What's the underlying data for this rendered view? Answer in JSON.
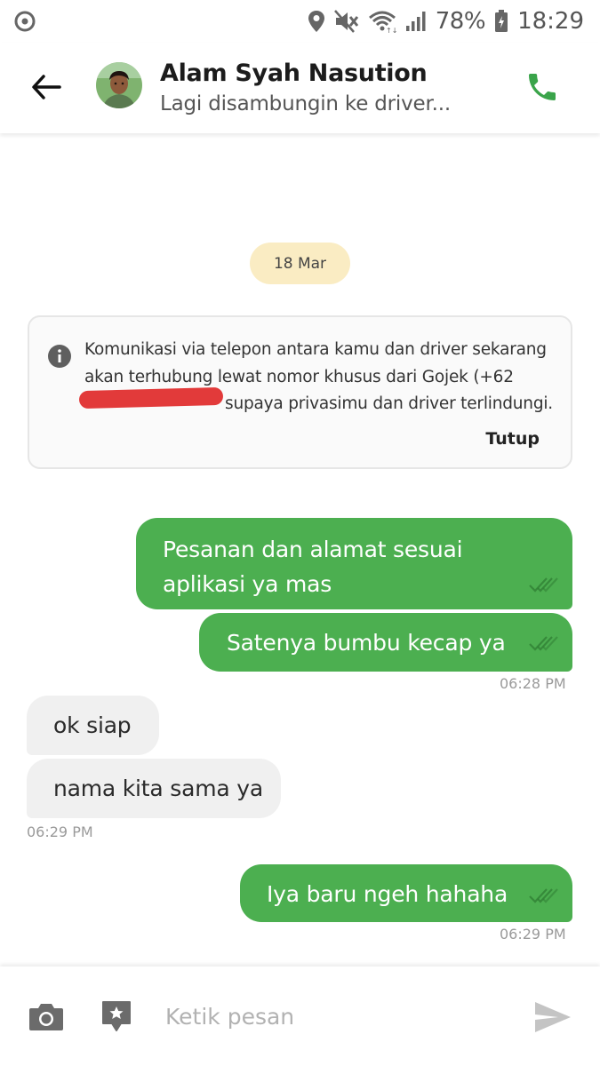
{
  "status_bar": {
    "battery_percent": "78%",
    "time": "18:29"
  },
  "header": {
    "contact_name": "Alam Syah Nasution",
    "contact_status": "Lagi disambungin ke driver..."
  },
  "chat": {
    "date_chip": "18 Mar",
    "info_card": {
      "line1": "Komunikasi via telepon antara kamu dan driver sekarang",
      "line2": "akan terhubung lewat nomor khusus dari Gojek (+62",
      "line3": "supaya privasimu dan driver terlindungi.",
      "close_label": "Tutup"
    },
    "messages": [
      {
        "direction": "out",
        "lines": [
          "Pesanan dan alamat sesuai",
          "aplikasi ya mas"
        ],
        "read": true
      },
      {
        "direction": "out",
        "lines": [
          "Satenya bumbu kecap ya"
        ],
        "read": true,
        "time": "06:28 PM"
      },
      {
        "direction": "in",
        "lines": [
          "ok siap"
        ]
      },
      {
        "direction": "in",
        "lines": [
          "nama kita sama ya"
        ],
        "time": "06:29 PM"
      },
      {
        "direction": "out",
        "lines": [
          "Iya baru ngeh hahaha"
        ],
        "read": true,
        "time": "06:29 PM"
      }
    ]
  },
  "composer": {
    "placeholder": "Ketik pesan",
    "value": ""
  },
  "colors": {
    "accent_green": "#4caf50",
    "date_chip_bg": "#faecc3",
    "incoming_bubble_bg": "#f0f0f0",
    "redaction_red": "#e23a3a"
  },
  "icons": [
    "location-icon",
    "mute-icon",
    "wifi-icon",
    "signal-icon",
    "battery-icon",
    "back-arrow-icon",
    "phone-icon",
    "info-icon",
    "double-check-icon",
    "camera-icon",
    "sticker-icon",
    "send-icon"
  ]
}
